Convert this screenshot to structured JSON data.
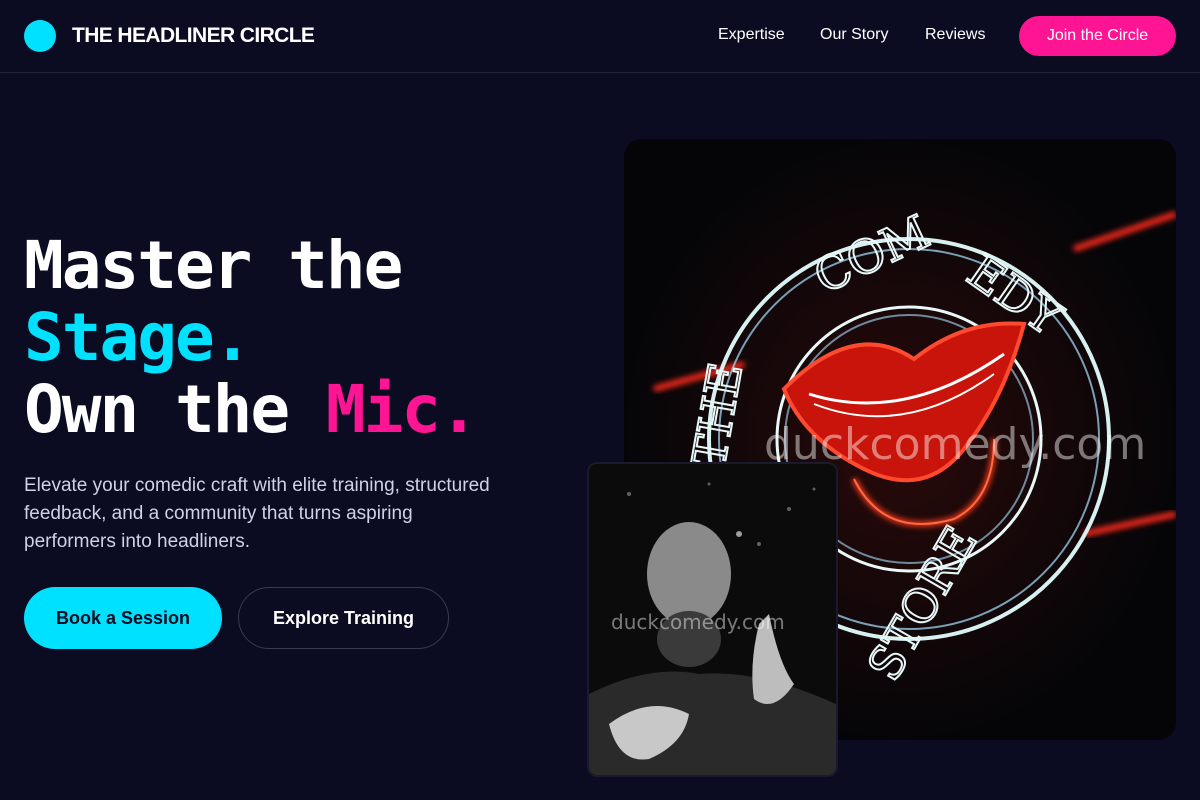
{
  "header": {
    "brand": "THE HEADLINER CIRCLE",
    "nav": {
      "expertise": "Expertise",
      "story": "Our Story",
      "reviews": "Reviews"
    },
    "cta_label": "Join the Circle"
  },
  "hero": {
    "line1": "Master the",
    "line2": "Stage.",
    "line3_prefix": "Own the ",
    "line3_accent": "Mic.",
    "subtext": "Elevate your comedic craft with elite training, structured feedback, and a community that turns aspiring performers into headliners.",
    "primary_button": "Book a Session",
    "secondary_button": "Explore Training"
  },
  "images": {
    "main_watermark": "duckcomedy.com",
    "inset_watermark": "duckcomedy.com"
  },
  "colors": {
    "background": "#0b0b22",
    "cyan_accent": "#00e0ff",
    "pink_accent": "#ff1493"
  }
}
